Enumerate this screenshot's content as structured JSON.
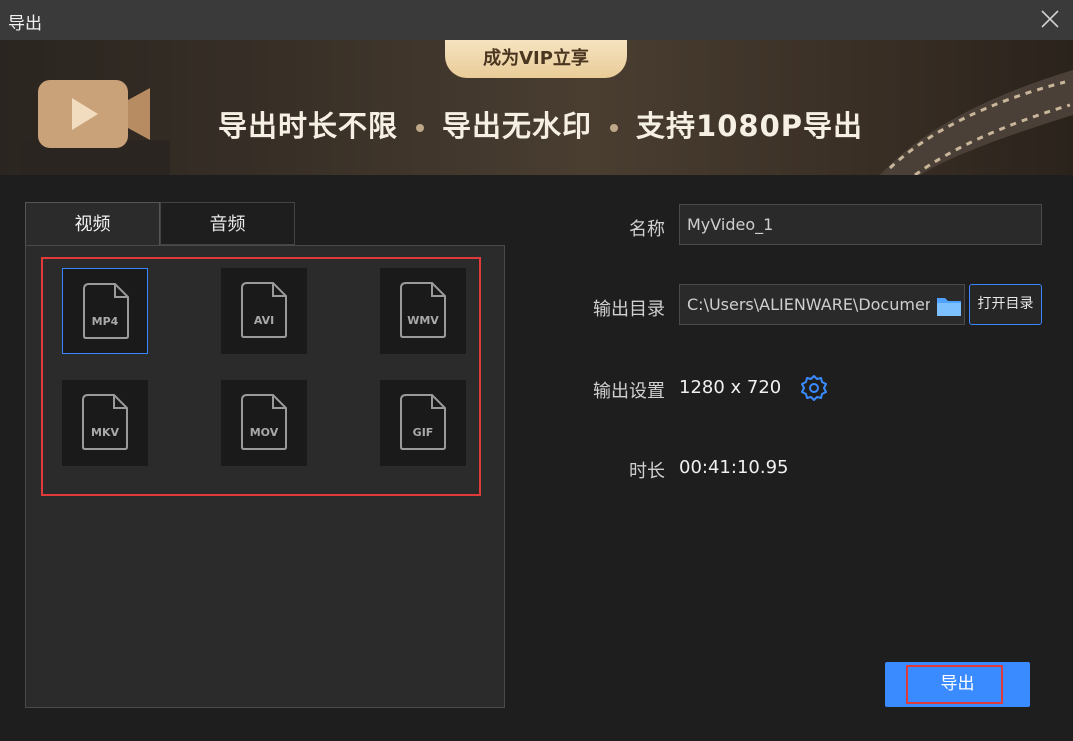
{
  "window": {
    "title": "导出"
  },
  "banner": {
    "vip_pill": "成为VIP立享",
    "benefits": [
      "导出时长不限",
      "导出无水印",
      "支持1080P导出"
    ]
  },
  "tabs": [
    {
      "label": "视频",
      "active": true
    },
    {
      "label": "音频",
      "active": false
    }
  ],
  "formats": [
    {
      "label": "MP4",
      "selected": true
    },
    {
      "label": "AVI",
      "selected": false
    },
    {
      "label": "WMV",
      "selected": false
    },
    {
      "label": "MKV",
      "selected": false
    },
    {
      "label": "MOV",
      "selected": false
    },
    {
      "label": "GIF",
      "selected": false
    }
  ],
  "settings": {
    "name_label": "名称",
    "name_value": "MyVideo_1",
    "dir_label": "输出目录",
    "dir_value": "C:\\Users\\ALIENWARE\\Documents\\",
    "open_dir_label": "打开目录",
    "output_label": "输出设置",
    "output_value": "1280 x 720",
    "duration_label": "时长",
    "duration_value": "00:41:10.95"
  },
  "export_button": "导出",
  "colors": {
    "accent": "#3a8bff",
    "highlight": "#e03a3a"
  }
}
